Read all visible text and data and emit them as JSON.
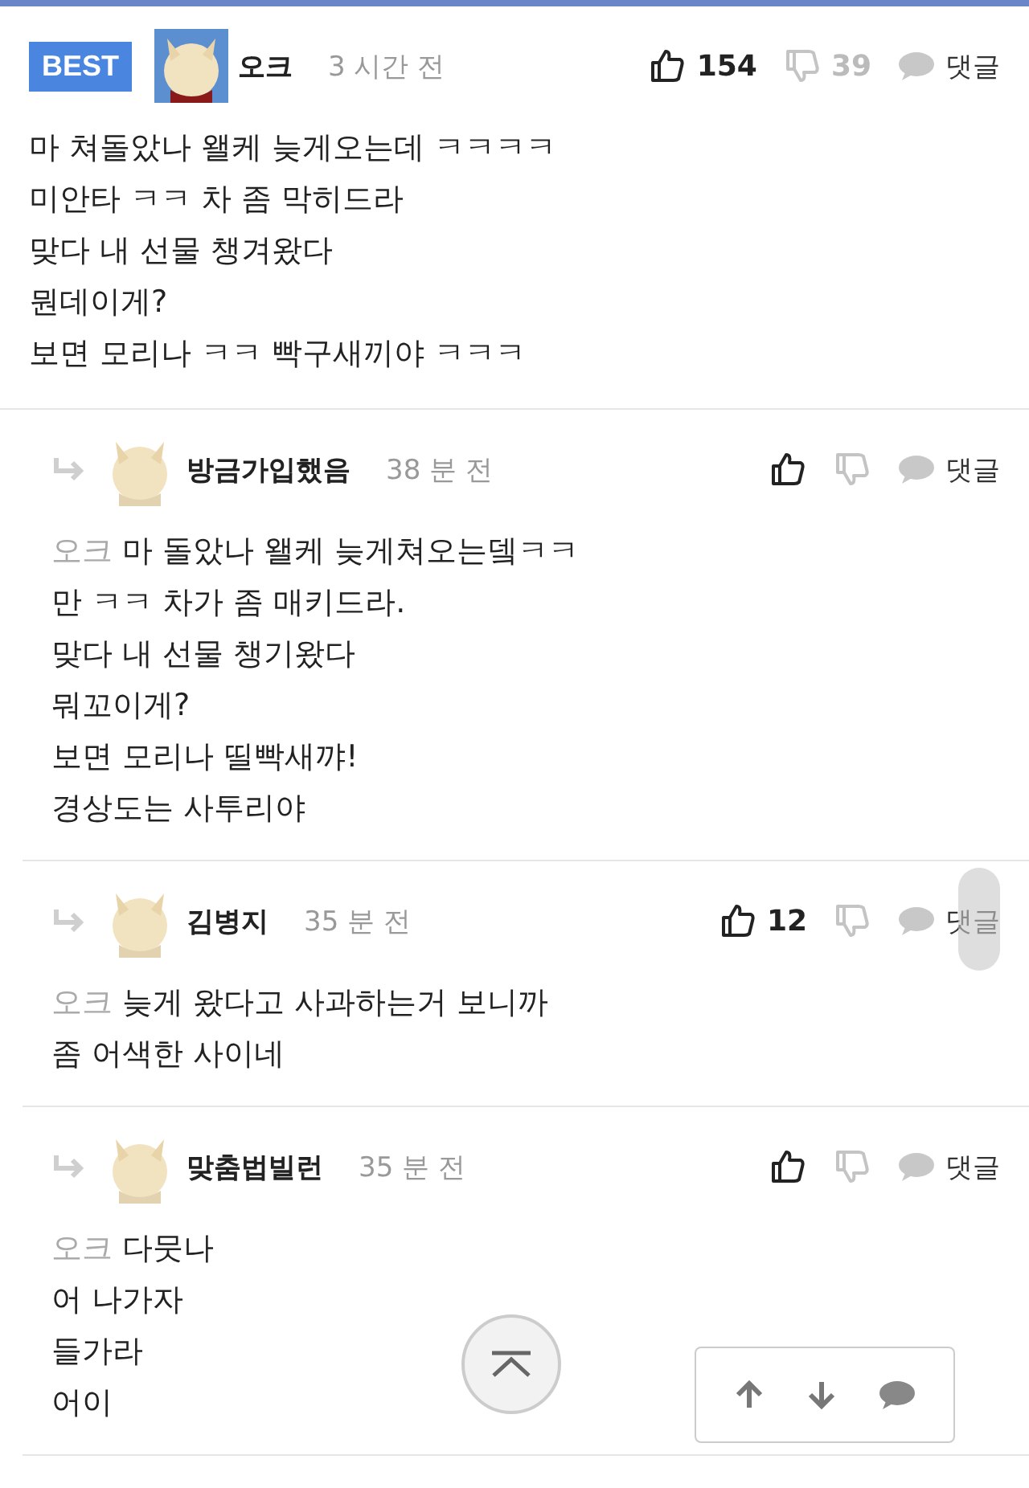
{
  "comments": [
    {
      "kind": "best",
      "badge": "BEST",
      "author": "오크",
      "time": "3 시간 전",
      "likes": "154",
      "dislikes": "39",
      "reply_label": "댓글",
      "lines": [
        "마 쳐돌았나 왤케 늦게오는데 ㅋㅋㅋㅋ",
        "미안타 ㅋㅋ 차 좀 막히드라",
        "맞다 내 선물 챙겨왔다",
        "뭔데이게?",
        "보면 모리나 ㅋㅋ 빡구새끼야 ㅋㅋㅋ"
      ]
    },
    {
      "kind": "reply",
      "author": "방금가입했음",
      "time": "38 분 전",
      "reply_label": "댓글",
      "mention": "오크",
      "lines": [
        "마 돌았나 왤케 늦게쳐오는뎈ㅋㅋ",
        "만 ㅋㅋ 차가 좀 매키드라.",
        "맞다 내 선물 챙기왔다",
        "뭐꼬이게?",
        "보면 모리나 띨빡새꺄!",
        "경상도는 사투리야"
      ]
    },
    {
      "kind": "reply",
      "author": "김병지",
      "time": "35 분 전",
      "likes": "12",
      "reply_label": "댓글",
      "mention": "오크",
      "lines": [
        "늦게 왔다고 사과하는거 보니까",
        "좀 어색한 사이네"
      ]
    },
    {
      "kind": "reply",
      "author": "맞춤법빌런",
      "time": "35 분 전",
      "reply_label": "댓글",
      "mention": "오크",
      "lines": [
        "다뭇나",
        "어 나가자",
        "들가라",
        "어이"
      ]
    }
  ]
}
